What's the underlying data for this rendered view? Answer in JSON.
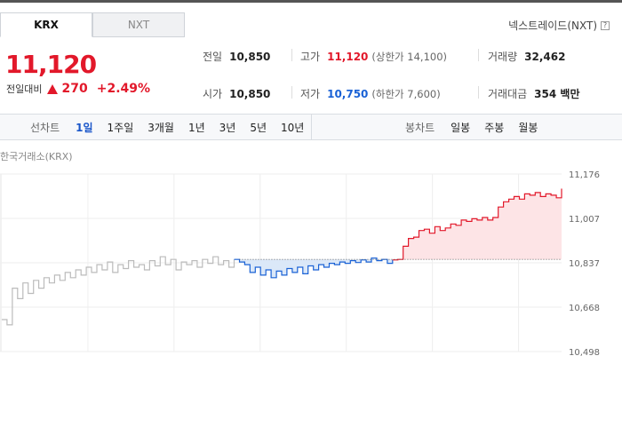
{
  "tabs": [
    {
      "label": "KRX",
      "active": true
    },
    {
      "label": "NXT",
      "active": false
    }
  ],
  "nxt_link": {
    "label": "넥스트레이드(NXT)",
    "icon": "help-icon"
  },
  "price": {
    "current": "11,120",
    "change_label": "전일대비",
    "change_value": "270",
    "change_pct": "+2.49%",
    "direction": "up"
  },
  "stats": {
    "prev_close": {
      "label": "전일",
      "value": "10,850"
    },
    "open": {
      "label": "시가",
      "value": "10,850"
    },
    "high": {
      "label": "고가",
      "value": "11,120",
      "sub": "(상한가 14,100)"
    },
    "low": {
      "label": "저가",
      "value": "10,750",
      "sub": "(하한가 7,600)"
    },
    "volume": {
      "label": "거래량",
      "value": "32,462"
    },
    "amount": {
      "label": "거래대금",
      "value": "354 백만"
    }
  },
  "line_chart_tabs": {
    "head": "선차트",
    "items": [
      "1일",
      "1주일",
      "3개월",
      "1년",
      "3년",
      "5년",
      "10년"
    ],
    "active": "1일"
  },
  "candle_chart_tabs": {
    "head": "봉차트",
    "items": [
      "일봉",
      "주봉",
      "월봉"
    ]
  },
  "exchange_label": "한국거래소(KRX)",
  "colors": {
    "up": "#e2182a",
    "down": "#1a62d6",
    "prior": "#bbbbbb",
    "up_fill": "#fde4e6",
    "down_fill": "#dbe8f8"
  },
  "chart_data": {
    "type": "line",
    "title": "",
    "xlabel": "",
    "ylabel": "",
    "ylim": [
      10498,
      11176
    ],
    "y_ticks": [
      "11,176",
      "11,007",
      "10,837",
      "10,668",
      "10,498"
    ],
    "reference": 10850,
    "grid": true,
    "segments": [
      {
        "name": "",
        "color": "prior",
        "values": [
          10620,
          10600,
          10740,
          10700,
          10760,
          10720,
          10770,
          10740,
          10780,
          10760,
          10790,
          10770,
          10800,
          10780,
          10810,
          10790,
          10820,
          10800,
          10830,
          10810,
          10840,
          10800,
          10830,
          10815,
          10845,
          10820,
          10830,
          10810,
          10845,
          10825,
          10860,
          10830,
          10850,
          10810,
          10840,
          10830,
          10845,
          10820,
          10850,
          10835,
          10860,
          10830,
          10845,
          10820,
          10850
        ]
      },
      {
        "name": "",
        "color": "down",
        "values": [
          10840,
          10830,
          10800,
          10820,
          10790,
          10810,
          10780,
          10805,
          10790,
          10815,
          10800,
          10820,
          10795,
          10825,
          10810,
          10830,
          10820,
          10835,
          10830,
          10840,
          10835,
          10845,
          10838,
          10848,
          10840,
          10855,
          10845,
          10850,
          10835,
          10848
        ]
      },
      {
        "name": "",
        "color": "up",
        "values": [
          10850,
          10900,
          10930,
          10935,
          10960,
          10965,
          10950,
          10975,
          10960,
          10970,
          10985,
          10980,
          11000,
          10995,
          11005,
          11000,
          11010,
          11000,
          11010,
          11050,
          11070,
          11080,
          11090,
          11080,
          11100,
          11095,
          11105,
          11090,
          11100,
          11095,
          11085,
          11120
        ]
      }
    ]
  }
}
